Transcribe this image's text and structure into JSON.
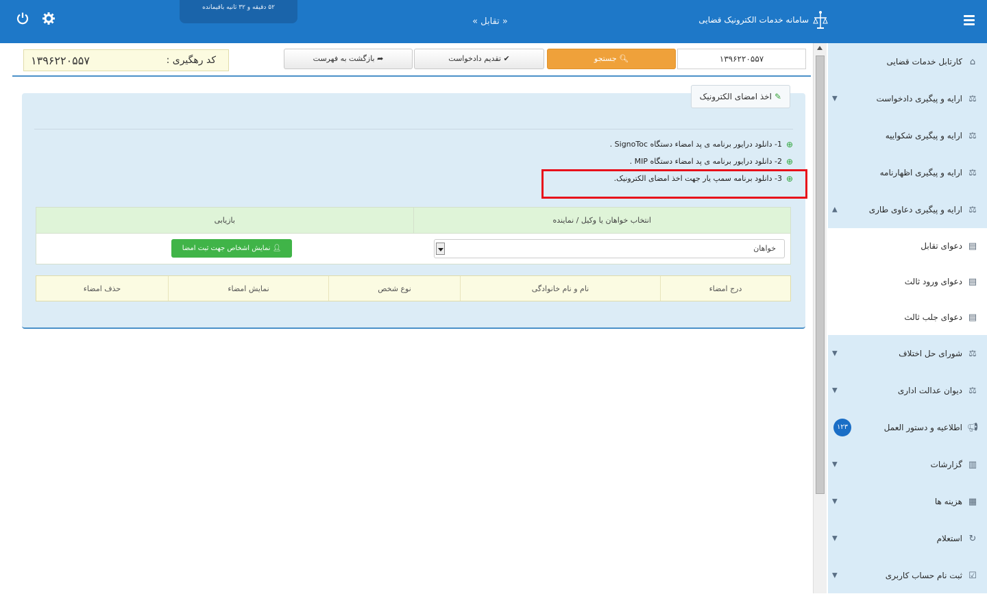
{
  "topbar": {
    "timer_text": "۵۲ دقیقه و ۳۲ ثانیه باقیمانده",
    "breadcrumb": "« تقابل »",
    "system_title": "سامانه خدمات الکترونیک قضایی",
    "power_icon": "power-icon",
    "gear_icon": "gear-icon",
    "menu_icon": "hamburger-menu-icon"
  },
  "toolbar": {
    "tracking_label": "کد رهگیری :",
    "tracking_value": "۱۳۹۶۲۲۰۵۵۷",
    "back_label": "بازگشت به فهرست",
    "submit_label": "تقدیم دادخواست",
    "search_label": "جستجو",
    "code_value": "۱۳۹۶۲۲۰۵۵۷"
  },
  "panel": {
    "tab_label": "اخذ امضای الکترونیک",
    "steps": [
      "1- دانلود درایور برنامه ی پد امضاء دستگاه SignoToc .",
      "2- دانلود درایور برنامه ی پد امضاء دستگاه MIP .",
      "3- دانلود برنامه سمپ یار جهت اخذ امضای الکترونیک."
    ]
  },
  "table1": {
    "col_select": "انتخاب خواهان یا وکیل / نماینده",
    "col_retrieve": "بازیابی",
    "select_value": "خواهان",
    "show_button": "نمایش اشخاص جهت ثبت امضا"
  },
  "table2": {
    "columns": [
      "درج امضاء",
      "نام و نام خانوادگی",
      "نوع شخص",
      "نمایش امضاء",
      "حذف امضاء"
    ]
  },
  "sidebar": {
    "items": [
      {
        "label": "کارتابل خدمات قضایی",
        "icon": "dashboard-icon"
      },
      {
        "label": "ارایه و پیگیری دادخواست",
        "icon": "scales-icon"
      },
      {
        "label": "ارایه و پیگیری شکواییه",
        "icon": "scales-icon"
      },
      {
        "label": "ارایه و پیگیری اظهارنامه",
        "icon": "scales-icon"
      },
      {
        "label": "ارایه و پیگیری دعاوی طاری",
        "icon": "scales-icon"
      },
      {
        "label": "دعوای تقابل",
        "icon": "document-icon"
      },
      {
        "label": "دعوای ورود ثالث",
        "icon": "document-icon"
      },
      {
        "label": "دعوای جلب ثالث",
        "icon": "document-icon"
      },
      {
        "label": "شورای حل اختلاف",
        "icon": "scales-icon"
      },
      {
        "label": "دیوان عدالت اداری",
        "icon": "scales-icon"
      },
      {
        "label": "اطلاعیه و دستور العمل",
        "icon": "megaphone-icon",
        "badge": "۱۲۳"
      },
      {
        "label": "گزارشات",
        "icon": "bar-chart-icon"
      },
      {
        "label": "هزینه ها",
        "icon": "calculator-icon"
      },
      {
        "label": "استعلام",
        "icon": "refresh-icon"
      },
      {
        "label": "ثبت نام حساب کاربری",
        "icon": "checkbox-icon"
      }
    ]
  }
}
